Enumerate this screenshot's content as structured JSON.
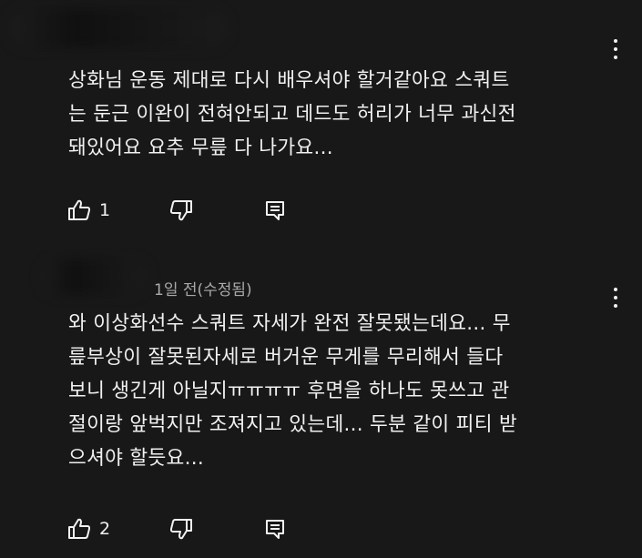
{
  "comments": [
    {
      "text": "상화님 운동 제대로 다시 배우셔야 할거같아요 스쿼트\n는 둔근 이완이 전혀안되고 데드도 허리가 너무 과신전\n돼있어요 요추 무릎 다 나가요...",
      "likes": "1"
    },
    {
      "meta": "1일 전(수정됨)",
      "text": "와 이상화선수 스쿼트 자세가 완전 잘못됐는데요... 무\n릎부상이 잘못된자세로 버거운 무게를 무리해서 들다\n보니 생긴게 아닐지ㅠㅠㅠㅠ 후면을 하나도 못쓰고 관\n절이랑 앞벅지만 조져지고 있는데... 두분 같이 피티 받\n으셔야 할듯요...",
      "likes": "2"
    }
  ],
  "icons": {
    "like": "thumb-up-icon",
    "dislike": "thumb-down-icon",
    "reply": "reply-icon",
    "more": "more-vert-icon"
  },
  "colors": {
    "background": "#181818",
    "text": "#f1f1f1",
    "meta": "#aaaaaa"
  }
}
